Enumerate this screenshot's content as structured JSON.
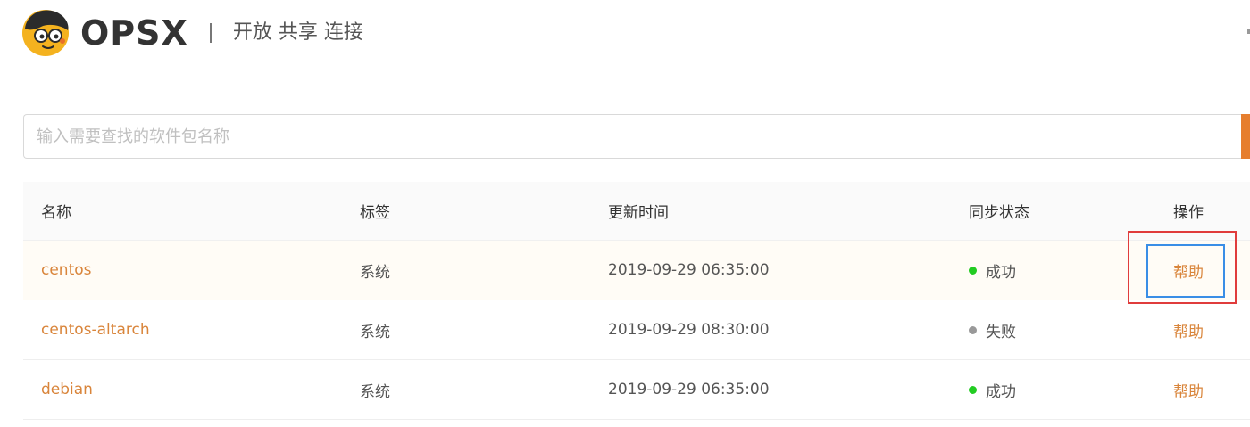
{
  "header": {
    "logo_text": "OPSX",
    "slogan": "开放 共享 连接"
  },
  "search": {
    "placeholder": "输入需要查找的软件包名称",
    "value": ""
  },
  "table": {
    "columns": {
      "name": "名称",
      "tag": "标签",
      "time": "更新时间",
      "status": "同步状态",
      "op": "操作"
    },
    "rows": [
      {
        "name": "centos",
        "tag": "系统",
        "time": "2019-09-29 06:35:00",
        "status": "成功",
        "status_color": "#22cc22",
        "op": "帮助"
      },
      {
        "name": "centos-altarch",
        "tag": "系统",
        "time": "2019-09-29 08:30:00",
        "status": "失败",
        "status_color": "#999999",
        "op": "帮助"
      },
      {
        "name": "debian",
        "tag": "系统",
        "time": "2019-09-29 06:35:00",
        "status": "成功",
        "status_color": "#22cc22",
        "op": "帮助"
      }
    ]
  },
  "colors": {
    "accent": "#e67e2e",
    "link": "#d9853b",
    "annotation_outer": "#e03c3c",
    "annotation_inner": "#3a8ee6"
  }
}
